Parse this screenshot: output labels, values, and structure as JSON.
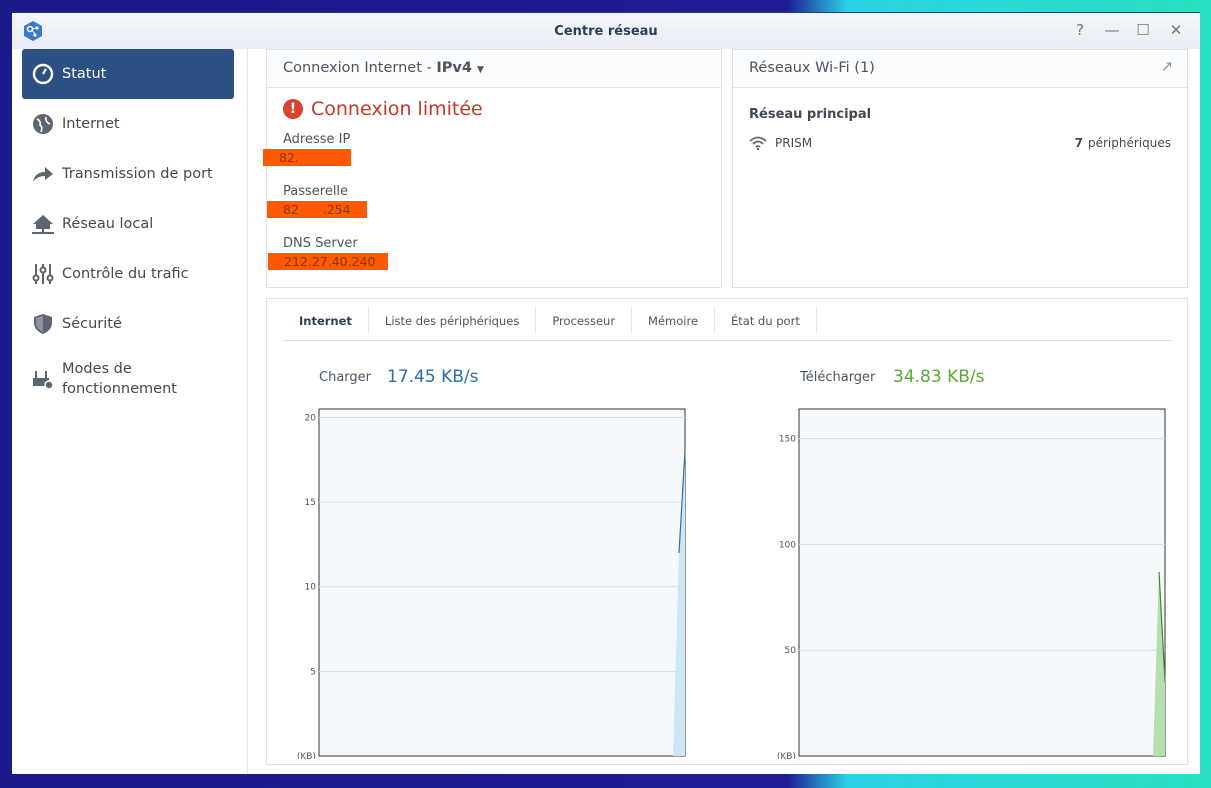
{
  "window": {
    "title": "Centre réseau",
    "controls": [
      "?",
      "—",
      "☐",
      "✕"
    ]
  },
  "sidebar": {
    "items": [
      {
        "label": "Statut",
        "icon": "gauge-icon",
        "active": true
      },
      {
        "label": "Internet",
        "icon": "globe-icon"
      },
      {
        "label": "Transmission de port",
        "icon": "share-arrow-icon"
      },
      {
        "label": "Réseau local",
        "icon": "home-network-icon"
      },
      {
        "label": "Contrôle du trafic",
        "icon": "sliders-icon"
      },
      {
        "label": "Sécurité",
        "icon": "shield-icon"
      },
      {
        "label": "Modes de fonctionnement",
        "icon": "router-gear-icon"
      }
    ]
  },
  "connection": {
    "header": "Connexion Internet - ",
    "protocol": "IPv4",
    "status": "Connexion limitée",
    "status_color": "#c0392b",
    "fields": [
      {
        "label": "Adresse IP",
        "value": "82."
      },
      {
        "label": "Passerelle",
        "value": "82      .254"
      },
      {
        "label": "DNS Server",
        "value": "212.27.40.240"
      }
    ]
  },
  "wifi": {
    "header": "Réseaux Wi-Fi (1)",
    "section": "Réseau principal",
    "ssid": "PRISM",
    "count": "7",
    "devices_label": "périphériques"
  },
  "tabs": [
    "Internet",
    "Liste des périphériques",
    "Processeur",
    "Mémoire",
    "État du port"
  ],
  "chart_data": [
    {
      "type": "area",
      "title": "Charger",
      "current": "17.45 KB/s",
      "color": "#2b6ea8",
      "fill": "#cfe6f5",
      "ylabel": "(KB)",
      "ylim": [
        0,
        20.5
      ],
      "yticks": [
        5,
        10,
        15,
        20
      ],
      "values": [
        0,
        0,
        0,
        0,
        0,
        0,
        0,
        0,
        0,
        0,
        0,
        0,
        0,
        0,
        0,
        0,
        0,
        0,
        0,
        0,
        0,
        0,
        0,
        0,
        0,
        0,
        0,
        0,
        0,
        0,
        0,
        0,
        0,
        0,
        0,
        0,
        0,
        0,
        0,
        0,
        0,
        0,
        0,
        0,
        0,
        0,
        0,
        0,
        0,
        0,
        0,
        0,
        0,
        0,
        0,
        0,
        0,
        0,
        12,
        18
      ]
    },
    {
      "type": "area",
      "title": "Télécharger",
      "current": "34.83 KB/s",
      "color": "#3c8c2c",
      "fill": "#b8ddb0",
      "ylabel": "(KB)",
      "ylim": [
        0,
        164
      ],
      "yticks": [
        50,
        100,
        150
      ],
      "values": [
        0,
        0,
        0,
        0,
        0,
        0,
        0,
        0,
        0,
        0,
        0,
        0,
        0,
        0,
        0,
        0,
        0,
        0,
        0,
        0,
        0,
        0,
        0,
        0,
        0,
        0,
        0,
        0,
        0,
        0,
        0,
        0,
        0,
        0,
        0,
        0,
        0,
        0,
        0,
        0,
        0,
        0,
        0,
        0,
        0,
        0,
        0,
        0,
        0,
        0,
        0,
        0,
        0,
        0,
        0,
        0,
        0,
        0,
        87,
        35
      ]
    }
  ]
}
